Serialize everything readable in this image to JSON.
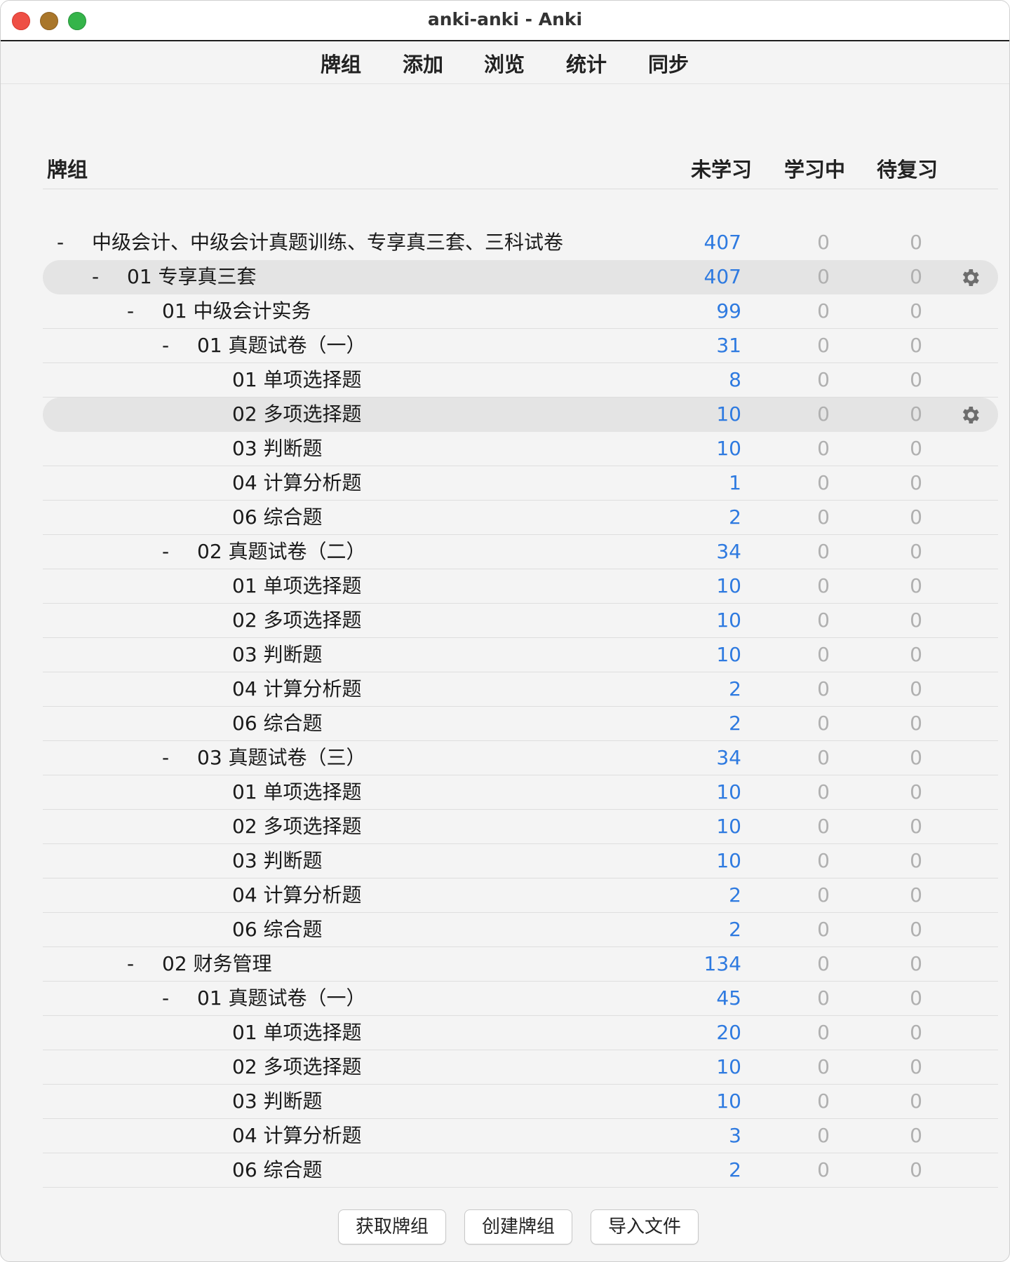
{
  "window": {
    "title": "anki-anki - Anki"
  },
  "toolbar": {
    "items": [
      "牌组",
      "添加",
      "浏览",
      "统计",
      "同步"
    ]
  },
  "table": {
    "headers": {
      "deck": "牌组",
      "new": "未学习",
      "learn": "学习中",
      "due": "待复习"
    },
    "rows": [
      {
        "name": "中级会计、中级会计真题训练、专享真三套、三科试卷",
        "depth": 0,
        "collapse": "-",
        "new": "407",
        "learn": "0",
        "due": "0",
        "highlight": false
      },
      {
        "name": "01 专享真三套",
        "depth": 1,
        "collapse": "-",
        "new": "407",
        "learn": "0",
        "due": "0",
        "highlight": true
      },
      {
        "name": "01 中级会计实务",
        "depth": 2,
        "collapse": "-",
        "new": "99",
        "learn": "0",
        "due": "0",
        "highlight": false
      },
      {
        "name": "01 真题试卷（一）",
        "depth": 3,
        "collapse": "-",
        "new": "31",
        "learn": "0",
        "due": "0",
        "highlight": false
      },
      {
        "name": "01 单项选择题",
        "depth": 4,
        "collapse": "",
        "new": "8",
        "learn": "0",
        "due": "0",
        "highlight": false
      },
      {
        "name": "02 多项选择题",
        "depth": 4,
        "collapse": "",
        "new": "10",
        "learn": "0",
        "due": "0",
        "highlight": true
      },
      {
        "name": "03 判断题",
        "depth": 4,
        "collapse": "",
        "new": "10",
        "learn": "0",
        "due": "0",
        "highlight": false
      },
      {
        "name": "04 计算分析题",
        "depth": 4,
        "collapse": "",
        "new": "1",
        "learn": "0",
        "due": "0",
        "highlight": false
      },
      {
        "name": "06 综合题",
        "depth": 4,
        "collapse": "",
        "new": "2",
        "learn": "0",
        "due": "0",
        "highlight": false
      },
      {
        "name": "02 真题试卷（二）",
        "depth": 3,
        "collapse": "-",
        "new": "34",
        "learn": "0",
        "due": "0",
        "highlight": false
      },
      {
        "name": "01 单项选择题",
        "depth": 4,
        "collapse": "",
        "new": "10",
        "learn": "0",
        "due": "0",
        "highlight": false
      },
      {
        "name": "02 多项选择题",
        "depth": 4,
        "collapse": "",
        "new": "10",
        "learn": "0",
        "due": "0",
        "highlight": false
      },
      {
        "name": "03 判断题",
        "depth": 4,
        "collapse": "",
        "new": "10",
        "learn": "0",
        "due": "0",
        "highlight": false
      },
      {
        "name": "04 计算分析题",
        "depth": 4,
        "collapse": "",
        "new": "2",
        "learn": "0",
        "due": "0",
        "highlight": false
      },
      {
        "name": "06 综合题",
        "depth": 4,
        "collapse": "",
        "new": "2",
        "learn": "0",
        "due": "0",
        "highlight": false
      },
      {
        "name": "03 真题试卷（三）",
        "depth": 3,
        "collapse": "-",
        "new": "34",
        "learn": "0",
        "due": "0",
        "highlight": false
      },
      {
        "name": "01 单项选择题",
        "depth": 4,
        "collapse": "",
        "new": "10",
        "learn": "0",
        "due": "0",
        "highlight": false
      },
      {
        "name": "02 多项选择题",
        "depth": 4,
        "collapse": "",
        "new": "10",
        "learn": "0",
        "due": "0",
        "highlight": false
      },
      {
        "name": "03 判断题",
        "depth": 4,
        "collapse": "",
        "new": "10",
        "learn": "0",
        "due": "0",
        "highlight": false
      },
      {
        "name": "04 计算分析题",
        "depth": 4,
        "collapse": "",
        "new": "2",
        "learn": "0",
        "due": "0",
        "highlight": false
      },
      {
        "name": "06 综合题",
        "depth": 4,
        "collapse": "",
        "new": "2",
        "learn": "0",
        "due": "0",
        "highlight": false
      },
      {
        "name": "02 财务管理",
        "depth": 2,
        "collapse": "-",
        "new": "134",
        "learn": "0",
        "due": "0",
        "highlight": false
      },
      {
        "name": "01 真题试卷（一）",
        "depth": 3,
        "collapse": "-",
        "new": "45",
        "learn": "0",
        "due": "0",
        "highlight": false
      },
      {
        "name": "01 单项选择题",
        "depth": 4,
        "collapse": "",
        "new": "20",
        "learn": "0",
        "due": "0",
        "highlight": false
      },
      {
        "name": "02 多项选择题",
        "depth": 4,
        "collapse": "",
        "new": "10",
        "learn": "0",
        "due": "0",
        "highlight": false
      },
      {
        "name": "03 判断题",
        "depth": 4,
        "collapse": "",
        "new": "10",
        "learn": "0",
        "due": "0",
        "highlight": false
      },
      {
        "name": "04 计算分析题",
        "depth": 4,
        "collapse": "",
        "new": "3",
        "learn": "0",
        "due": "0",
        "highlight": false
      },
      {
        "name": "06 综合题",
        "depth": 4,
        "collapse": "",
        "new": "2",
        "learn": "0",
        "due": "0",
        "highlight": false
      }
    ]
  },
  "buttons": {
    "get_shared": "获取牌组",
    "create_deck": "创建牌组",
    "import_file": "导入文件"
  },
  "colors": {
    "new_count": "#2e7ae0",
    "zero_count": "#b0b0b0",
    "highlight_row": "#e4e4e4"
  },
  "icons": {
    "row_options": "gear-icon"
  }
}
